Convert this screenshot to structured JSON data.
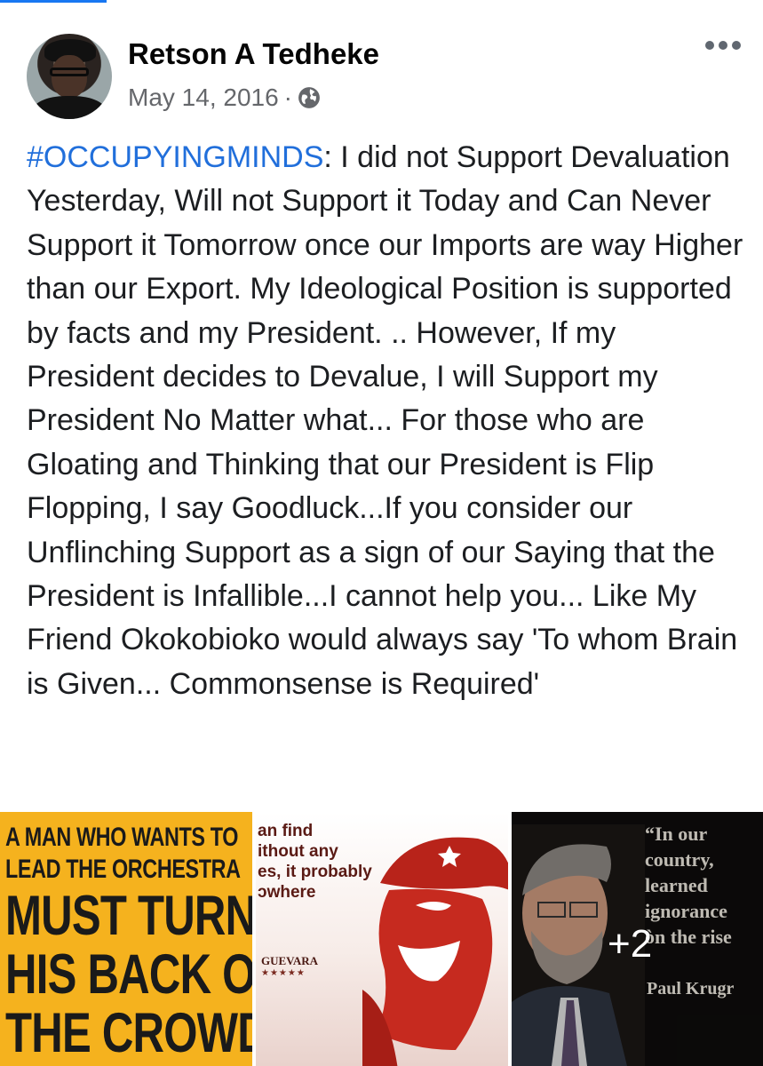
{
  "post": {
    "author": "Retson A Tedheke",
    "date": "May 14, 2016",
    "separator": "·",
    "privacy_icon": "globe-icon",
    "more_icon": "more-options-icon",
    "hashtag": "#OCCUPYINGMINDS",
    "body": ": I did not Support Devaluation Yesterday,  Will not Support it Today and Can Never Support it Tomorrow once our Imports are way Higher than our Export. My Ideological Position is supported by facts and my President. .. However,  If my President decides to Devalue,  I will Support my President No Matter what... For those who are Gloating and Thinking that our President is Flip Flopping, I say Goodluck...If you consider our Unflinching Support as a sign of our Saying that the President is Infallible...I cannot help you... Like My Friend Okokobioko would always say 'To whom Brain is Given... Commonsense is Required'"
  },
  "gallery": {
    "tile1": {
      "line1": "A MAN WHO WANTS TO",
      "line2": "LEAD THE ORCHESTRA",
      "line3": "MUST TURN",
      "line4": "HIS BACK ON",
      "line5": "THE CROWD."
    },
    "tile2": {
      "text": "an find\nithout any\nes, it probably\nɔwhere",
      "signature": "GUEVARA",
      "stars": "★★★★★"
    },
    "tile3": {
      "quote": "“In our\ncountry,\nlearned\nignorance\nòn the rise",
      "author": "Paul Krugr",
      "more_count": "+2"
    }
  },
  "colors": {
    "hashtag": "#216fdb",
    "meta": "#65676b",
    "tile1_bg": "#f5b21e"
  }
}
